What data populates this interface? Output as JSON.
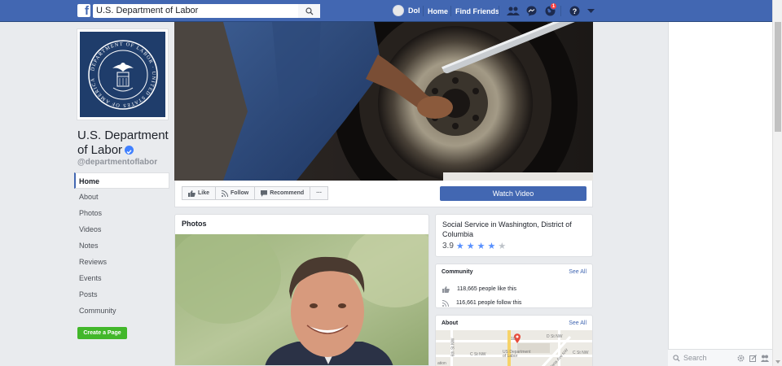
{
  "topbar": {
    "logo": "f",
    "search_value": "U.S. Department of Labor",
    "user_name": "Dol",
    "home_label": "Home",
    "find_friends_label": "Find Friends",
    "notification_count": "1"
  },
  "page": {
    "name": "U.S. Department of Labor",
    "handle": "@departmentoflabor",
    "seal_text": "DEPARTMENT OF LABOR · UNITED STATES OF AMERICA"
  },
  "side_nav": {
    "items": [
      "Home",
      "About",
      "Photos",
      "Videos",
      "Notes",
      "Reviews",
      "Events",
      "Posts",
      "Community"
    ],
    "create_page_label": "Create a Page"
  },
  "actions": {
    "like": "Like",
    "follow": "Follow",
    "recommend": "Recommend",
    "more": "···",
    "watch_video": "Watch Video"
  },
  "photos": {
    "title": "Photos"
  },
  "info": {
    "category": "Social Service in Washington, District of Columbia",
    "rating": "3.9",
    "rating_value": 3.9,
    "rating_max": 5
  },
  "community": {
    "title": "Community",
    "see_all": "See All",
    "likes": "118,665 people like this",
    "follows": "116,661 people follow this"
  },
  "about": {
    "title": "About",
    "see_all": "See All",
    "map_labels": [
      "D St NW",
      "C St NW",
      "C St NW",
      "US Department of Labor",
      "Indiana Ave NW",
      "6th St NW",
      "ation",
      "10"
    ]
  },
  "chat": {
    "search_placeholder": "Search"
  },
  "colors": {
    "brand_blue": "#4267b2",
    "create_green": "#42b72a",
    "badge_red": "#fa3e3e"
  }
}
